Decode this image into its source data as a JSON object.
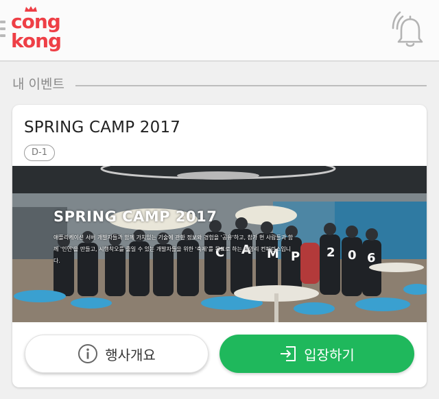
{
  "header": {
    "logo_line1": "cong",
    "logo_line2": "kong",
    "menu_icon": "menu-icon",
    "bell_icon": "bell-icon"
  },
  "section": {
    "title": "내 이벤트"
  },
  "event": {
    "title": "SPRING CAMP 2017",
    "dday": "D-1",
    "image_title": "SPRING CAMP 2017",
    "image_description": "애플리케이션 서버 개발자들과 함께 가치있는 기술에 관한 정보와 경험을 '공유'하고, 참가 현 사람들과 함께 '인연'을 만들고, 시행착오를 줄일 수 있는 개발자들을 위한 '축제'를 목표로 하는 비영리 컨퍼런스입니다.",
    "info_button": "행사개요",
    "enter_button": "입장하기"
  },
  "colors": {
    "brand": "#ee3f46",
    "enter_button": "#1fb85c",
    "background": "#f0f0f0"
  }
}
